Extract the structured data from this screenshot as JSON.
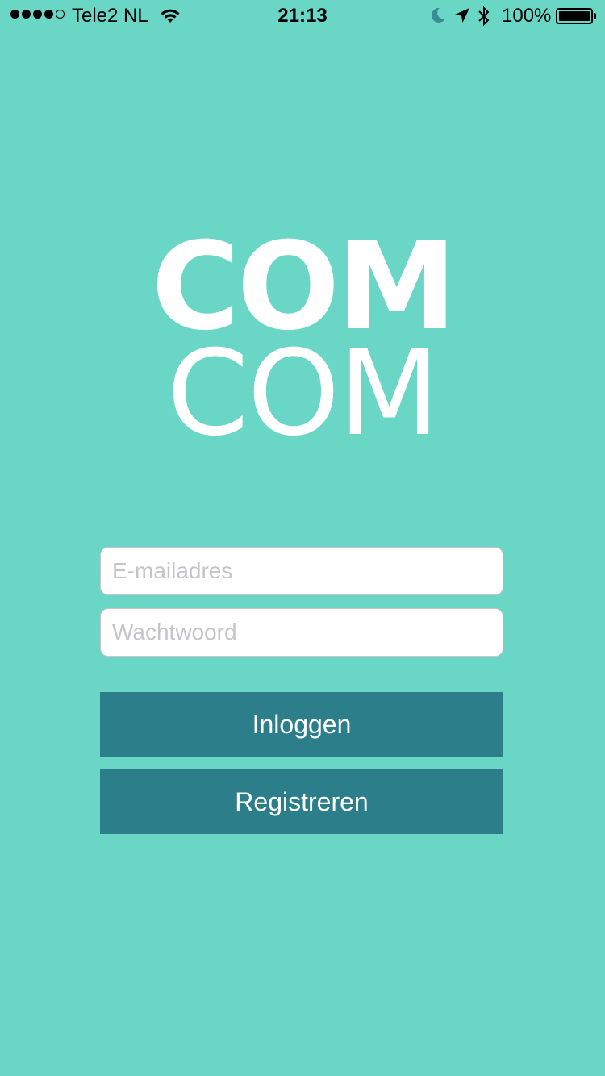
{
  "status_bar": {
    "signal_filled": 4,
    "signal_total": 5,
    "carrier": "Tele2 NL",
    "time": "21:13",
    "battery": "100%",
    "icons": [
      "wifi-icon",
      "moon-icon",
      "location-arrow-icon",
      "bluetooth-icon",
      "battery-icon"
    ]
  },
  "logo": {
    "line1": "COM",
    "line2": "COM"
  },
  "form": {
    "email_placeholder": "E-mailadres",
    "password_placeholder": "Wachtwoord"
  },
  "buttons": {
    "login": "Inloggen",
    "register": "Registreren"
  },
  "colors": {
    "background": "#6ad6c5",
    "button": "#2d7e8b",
    "text_light": "#ffffff"
  }
}
